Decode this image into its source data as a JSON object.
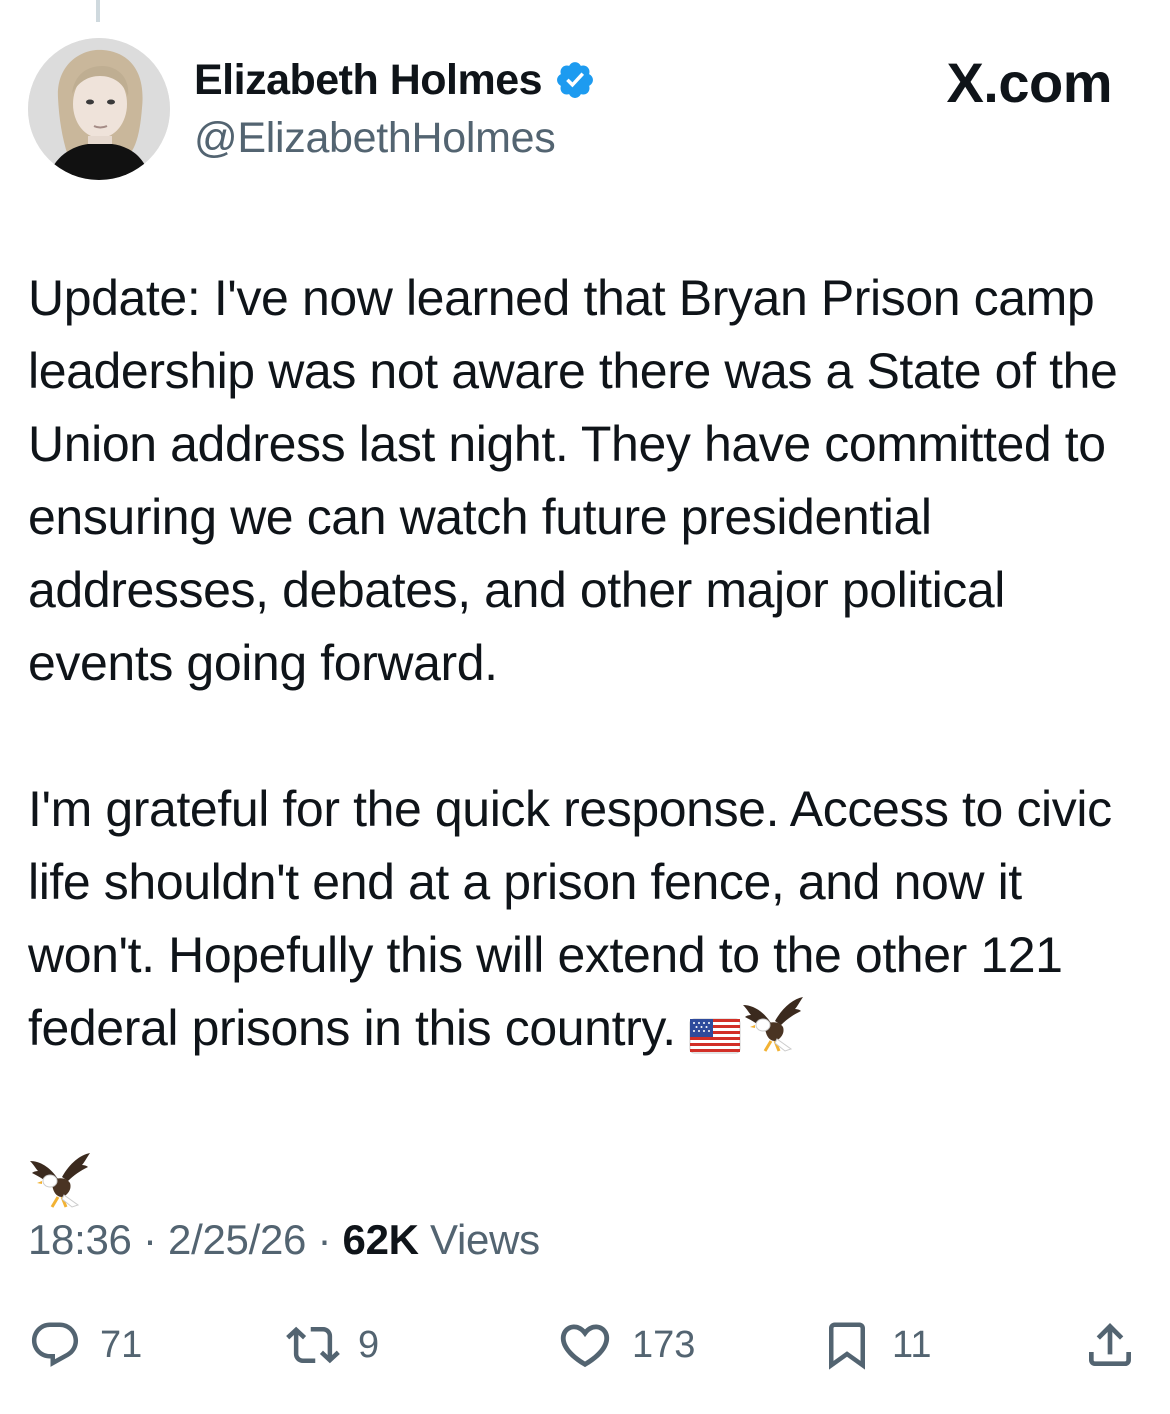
{
  "author": {
    "display_name": "Elizabeth Holmes",
    "handle": "@ElizabethHolmes",
    "verified_icon": "verified-badge-icon",
    "verified_color": "#1d9bf0"
  },
  "source_logo": "X.com",
  "tweet": {
    "paragraph_1": "Update: I've now learned that Bryan Prison camp leadership was not aware there was a State of the Union address last night. They have committed to ensuring we can watch future presidential addresses, debates, and other major political events going forward.",
    "paragraph_2": "I'm grateful for the quick response. Access to civic life shouldn't end at a prison fence, and now it won't. Hopefully this will extend to the other 121 federal prisons in this country.",
    "emojis": [
      "us-flag-icon",
      "eagle-icon",
      "eagle-icon"
    ]
  },
  "meta": {
    "time": "18:36",
    "separator": "·",
    "date": "2/25/26",
    "views_count": "62K",
    "views_label": "Views"
  },
  "actions": {
    "reply_count": "71",
    "repost_count": "9",
    "like_count": "173",
    "bookmark_count": "11"
  },
  "colors": {
    "text": "#0f1419",
    "secondary_text": "#536471",
    "accent": "#1d9bf0"
  }
}
